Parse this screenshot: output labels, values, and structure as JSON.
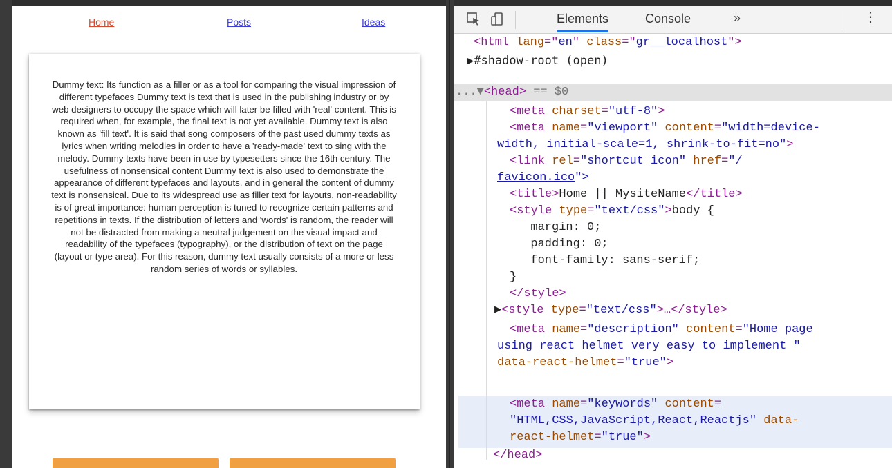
{
  "page": {
    "nav": {
      "home": "Home",
      "posts": "Posts",
      "ideas": "Ideas"
    },
    "body_text": "Dummy text: Its function as a filler or as a tool for comparing the visual impression of different typefaces Dummy text is text that is used in the publishing industry or by web designers to occupy the space which will later be filled with 'real' content. This is required when, for example, the final text is not yet available. Dummy text is also known as 'fill text'. It is said that song composers of the past used dummy texts as lyrics when writing melodies in order to have a 'ready-made' text to sing with the melody. Dummy texts have been in use by typesetters since the 16th century. The usefulness of nonsensical content Dummy text is also used to demonstrate the appearance of different typefaces and layouts, and in general the content of dummy text is nonsensical. Due to its widespread use as filler text for layouts, non-readability is of great importance: human perception is tuned to recognize certain patterns and repetitions in texts. If the distribution of letters and 'words' is random, the reader will not be distracted from making a neutral judgement on the visual impact and readability of the typefaces (typography), or the distribution of text on the page (layout or type area). For this reason, dummy text usually consists of a more or less random series of words or syllables."
  },
  "devtools": {
    "tabs": {
      "elements": "Elements",
      "console": "Console",
      "more": "»",
      "menu": "⋮"
    },
    "lines": {
      "l1": {
        "a": "<html ",
        "b": "lang",
        "c": "=\"",
        "d": "en",
        "e": "\" ",
        "f": "class",
        "g": "=\"",
        "h": "gr__localhost",
        "i": "\">"
      },
      "l2": "▶#shadow-root (open)",
      "l3": {
        "prefix": "...▼",
        "tag": "<head>",
        "rest": " == $0"
      },
      "l4": {
        "tag": "<meta ",
        "attr": "charset",
        "val": "\"utf-8\"",
        "end": ">"
      },
      "l5": {
        "tag": "<meta ",
        "attr1": "name",
        "val1": "\"viewport\"",
        "attr2": " content",
        "val2": "\"width=device-"
      },
      "l6": {
        "val": "width, initial-scale=1, shrink-to-fit=no\"",
        "end": ">"
      },
      "l7": {
        "tag": "<link ",
        "attr1": "rel",
        "val1": "\"shortcut icon\"",
        "attr2": " href",
        "val2": "\"/"
      },
      "l8": {
        "link": "favicon.ico",
        "end": "\">"
      },
      "l9": {
        "open": "<title>",
        "text": "Home || MysiteName",
        "close": "</title>"
      },
      "l10": {
        "tag": "<style ",
        "attr": "type",
        "val": "\"text/css\"",
        "end": ">",
        "text": "body {"
      },
      "l11": "  margin: 0;",
      "l12": "  padding: 0;",
      "l13": "  font-family: sans-serif;",
      "l14": "}",
      "l15": "</style>",
      "l16": {
        "arrow": "▶",
        "tag": "<style ",
        "attr": "type",
        "val": "\"text/css\"",
        "end": ">…</style>"
      },
      "l17": {
        "tag": "<meta ",
        "attr1": "name",
        "val1": "\"description\"",
        "attr2": " content",
        "val2": "\"Home page"
      },
      "l18": "using react helmet very easy to implement \"",
      "l19": {
        "attr": "data-react-helmet",
        "val": "\"true\"",
        "end": ">"
      },
      "l20": {
        "tag": "<meta ",
        "attr1": "name",
        "val1": "\"keywords\"",
        "attr2": " content",
        "eq": "="
      },
      "l21": {
        "val": "\"HTML,CSS,JavaScript,React,Reactjs\"",
        "attr": " data-"
      },
      "l22": {
        "attr": "react-helmet",
        "val": "\"true\"",
        "end": ">"
      },
      "l23": "</head>"
    }
  }
}
